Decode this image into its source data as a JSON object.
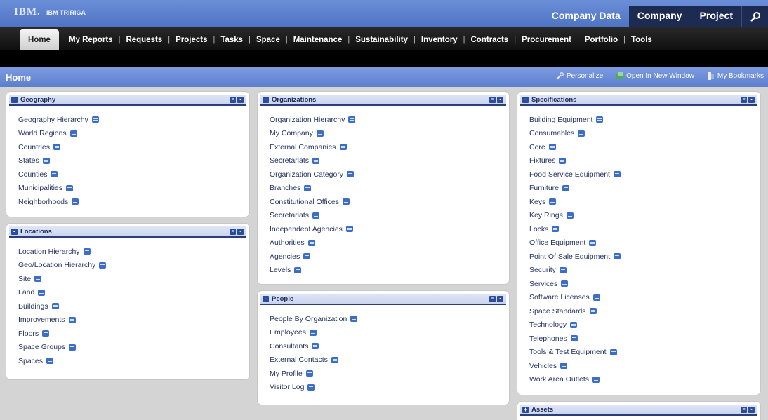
{
  "brand": {
    "logo": "IBM.",
    "product": "IBM TRIRIGA"
  },
  "topnav": {
    "company_data": "Company Data",
    "company": "Company",
    "project": "Project"
  },
  "menu": [
    "Home",
    "My Reports",
    "Requests",
    "Projects",
    "Tasks",
    "Space",
    "Maintenance",
    "Sustainability",
    "Inventory",
    "Contracts",
    "Procurement",
    "Portfolio",
    "Tools"
  ],
  "page": {
    "title": "Home",
    "personalize": "Personalize",
    "open_new_window": "Open In New Window",
    "bookmarks": "My Bookmarks"
  },
  "panels": {
    "geography": {
      "title": "Geography",
      "items": [
        "Geography Hierarchy",
        "World Regions",
        "Countries",
        "States",
        "Counties",
        "Municipalities",
        "Neighborhoods"
      ]
    },
    "locations": {
      "title": "Locations",
      "items": [
        "Location Hierarchy",
        "Geo/Location Hierarchy",
        "Site",
        "Land",
        "Buildings",
        "Improvements",
        "Floors",
        "Space Groups",
        "Spaces"
      ]
    },
    "organizations": {
      "title": "Organizations",
      "items": [
        "Organization Hierarchy",
        "My Company",
        "External Companies",
        "Secretariats",
        "Organization Category",
        "Branches",
        "Constitutional Offices",
        "Secretariats",
        "Independent Agencies",
        "Authorities",
        "Agencies",
        "Levels"
      ]
    },
    "people": {
      "title": "People",
      "items": [
        "People By Organization",
        "Employees",
        "Consultants",
        "External Contacts",
        "My Profile",
        "Visitor Log"
      ]
    },
    "specifications": {
      "title": "Specifications",
      "items": [
        "Building Equipment",
        "Consumables",
        "Core",
        "Fixtures",
        "Food Service Equipment",
        "Furniture",
        "Keys",
        "Key Rings",
        "Locks",
        "Office Equipment",
        "Point Of Sale Equipment",
        "Security",
        "Services",
        "Software Licenses",
        "Space Standards",
        "Technology",
        "Telephones",
        "Tools & Test Equipment",
        "Vehicles",
        "Work Area Outlets"
      ]
    },
    "assets": {
      "title": "Assets",
      "items": []
    }
  },
  "colors": {
    "banner": "#5a7ccb",
    "menubar": "#111111",
    "panel_title": "#1b2b5c",
    "link": "#253462",
    "report_icon": "#3d6ec5"
  }
}
